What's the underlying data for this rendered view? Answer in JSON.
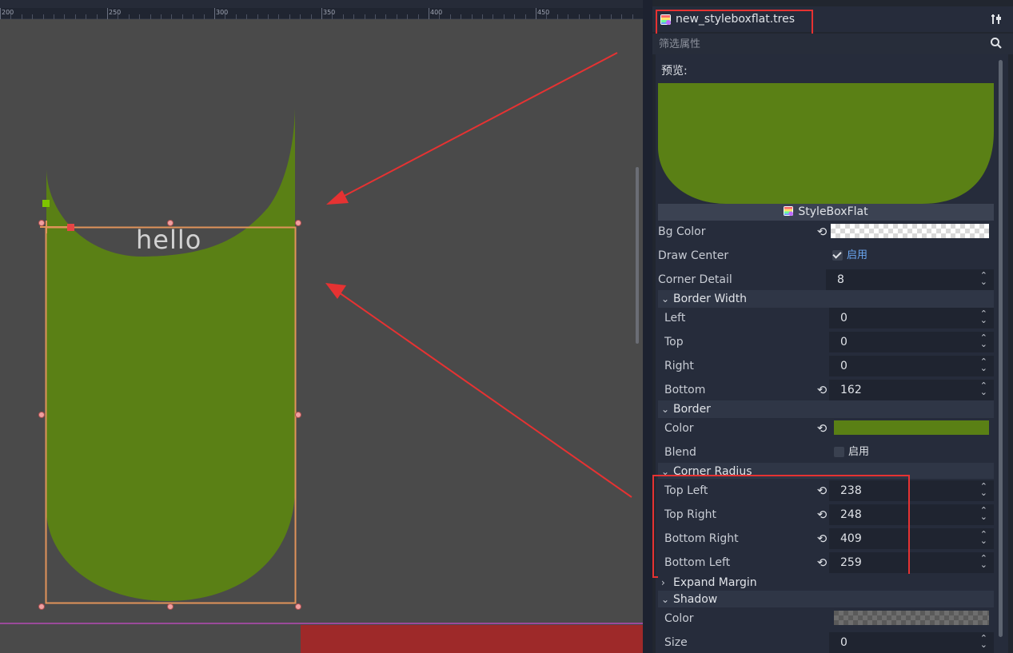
{
  "viewport": {
    "ruler_ticks": [
      "200",
      "250",
      "300",
      "350",
      "400",
      "450"
    ],
    "node_text": "hello",
    "colors": {
      "fill": "#5a8015",
      "selection": "#e0935a",
      "handle": "#f0a0a0",
      "arrow": "#e63232",
      "anchor": "#7ec400",
      "bottom_bar": "#9e2929"
    }
  },
  "inspector": {
    "resource_name": "new_styleboxflat.tres",
    "filter_placeholder": "筛选属性",
    "preview_label": "预览:",
    "class_name": "StyleBoxFlat",
    "bg_color": {
      "label": "Bg Color"
    },
    "draw_center": {
      "label": "Draw Center",
      "value": "启用",
      "checked": true
    },
    "corner_detail": {
      "label": "Corner Detail",
      "value": "8"
    },
    "border_width": {
      "title": "Border Width",
      "left": {
        "label": "Left",
        "value": "0"
      },
      "top": {
        "label": "Top",
        "value": "0"
      },
      "right": {
        "label": "Right",
        "value": "0"
      },
      "bottom": {
        "label": "Bottom",
        "value": "162"
      }
    },
    "border": {
      "title": "Border",
      "color": {
        "label": "Color",
        "value": "#5a8015"
      },
      "blend": {
        "label": "Blend",
        "value": "启用",
        "checked": false
      }
    },
    "corner_radius": {
      "title": "Corner Radius",
      "top_left": {
        "label": "Top Left",
        "value": "238"
      },
      "top_right": {
        "label": "Top Right",
        "value": "248"
      },
      "bottom_right": {
        "label": "Bottom Right",
        "value": "409"
      },
      "bottom_left": {
        "label": "Bottom Left",
        "value": "259"
      }
    },
    "expand_margin": {
      "title": "Expand Margin"
    },
    "shadow": {
      "title": "Shadow",
      "color": {
        "label": "Color"
      },
      "size": {
        "label": "Size",
        "value": "0"
      }
    }
  }
}
